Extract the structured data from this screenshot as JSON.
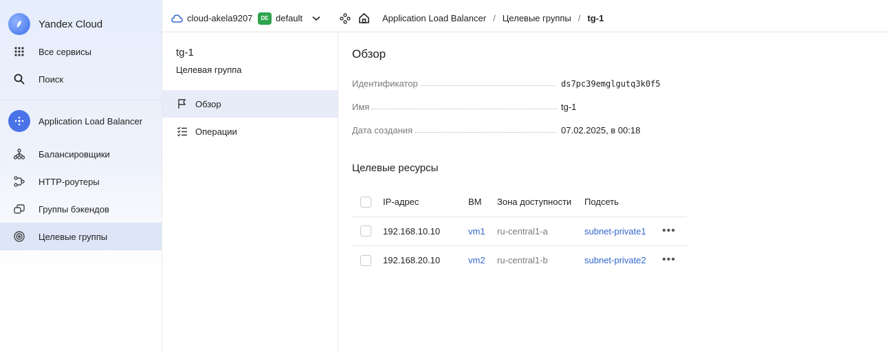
{
  "brand": {
    "name": "Yandex Cloud"
  },
  "nav": {
    "all_services": "Все сервисы",
    "search": "Поиск",
    "service": "Application Load Balancer",
    "items": [
      {
        "label": "Балансировщики",
        "icon": "balancer-icon"
      },
      {
        "label": "HTTP-роутеры",
        "icon": "router-icon"
      },
      {
        "label": "Группы бэкендов",
        "icon": "backend-groups-icon"
      },
      {
        "label": "Целевые группы",
        "icon": "target-icon",
        "active": true
      }
    ]
  },
  "topbar": {
    "cloud": "cloud-akela9207",
    "folder_badge": "DE",
    "folder": "default",
    "breadcrumbs": [
      "Application Load Balancer",
      "Целевые группы",
      "tg-1"
    ],
    "separator": "/"
  },
  "sub": {
    "title": "tg-1",
    "subtitle": "Целевая группа",
    "items": [
      {
        "label": "Обзор",
        "icon": "flag-icon",
        "active": true
      },
      {
        "label": "Операции",
        "icon": "list-icon"
      }
    ]
  },
  "overview": {
    "heading": "Обзор",
    "props": [
      {
        "key": "Идентификатор",
        "value": "ds7pc39emglgutq3k0f5",
        "mono": true
      },
      {
        "key": "Имя",
        "value": "tg-1"
      },
      {
        "key": "Дата создания",
        "value": "07.02.2025, в 00:18"
      }
    ]
  },
  "resources": {
    "heading": "Целевые ресурсы",
    "columns": [
      "IP-адрес",
      "ВМ",
      "Зона доступности",
      "Подсеть"
    ],
    "rows": [
      {
        "ip": "192.168.10.10",
        "vm": "vm1",
        "zone": "ru-central1-a",
        "subnet": "subnet-private1"
      },
      {
        "ip": "192.168.20.10",
        "vm": "vm2",
        "zone": "ru-central1-b",
        "subnet": "subnet-private2"
      }
    ],
    "more": "•••"
  }
}
